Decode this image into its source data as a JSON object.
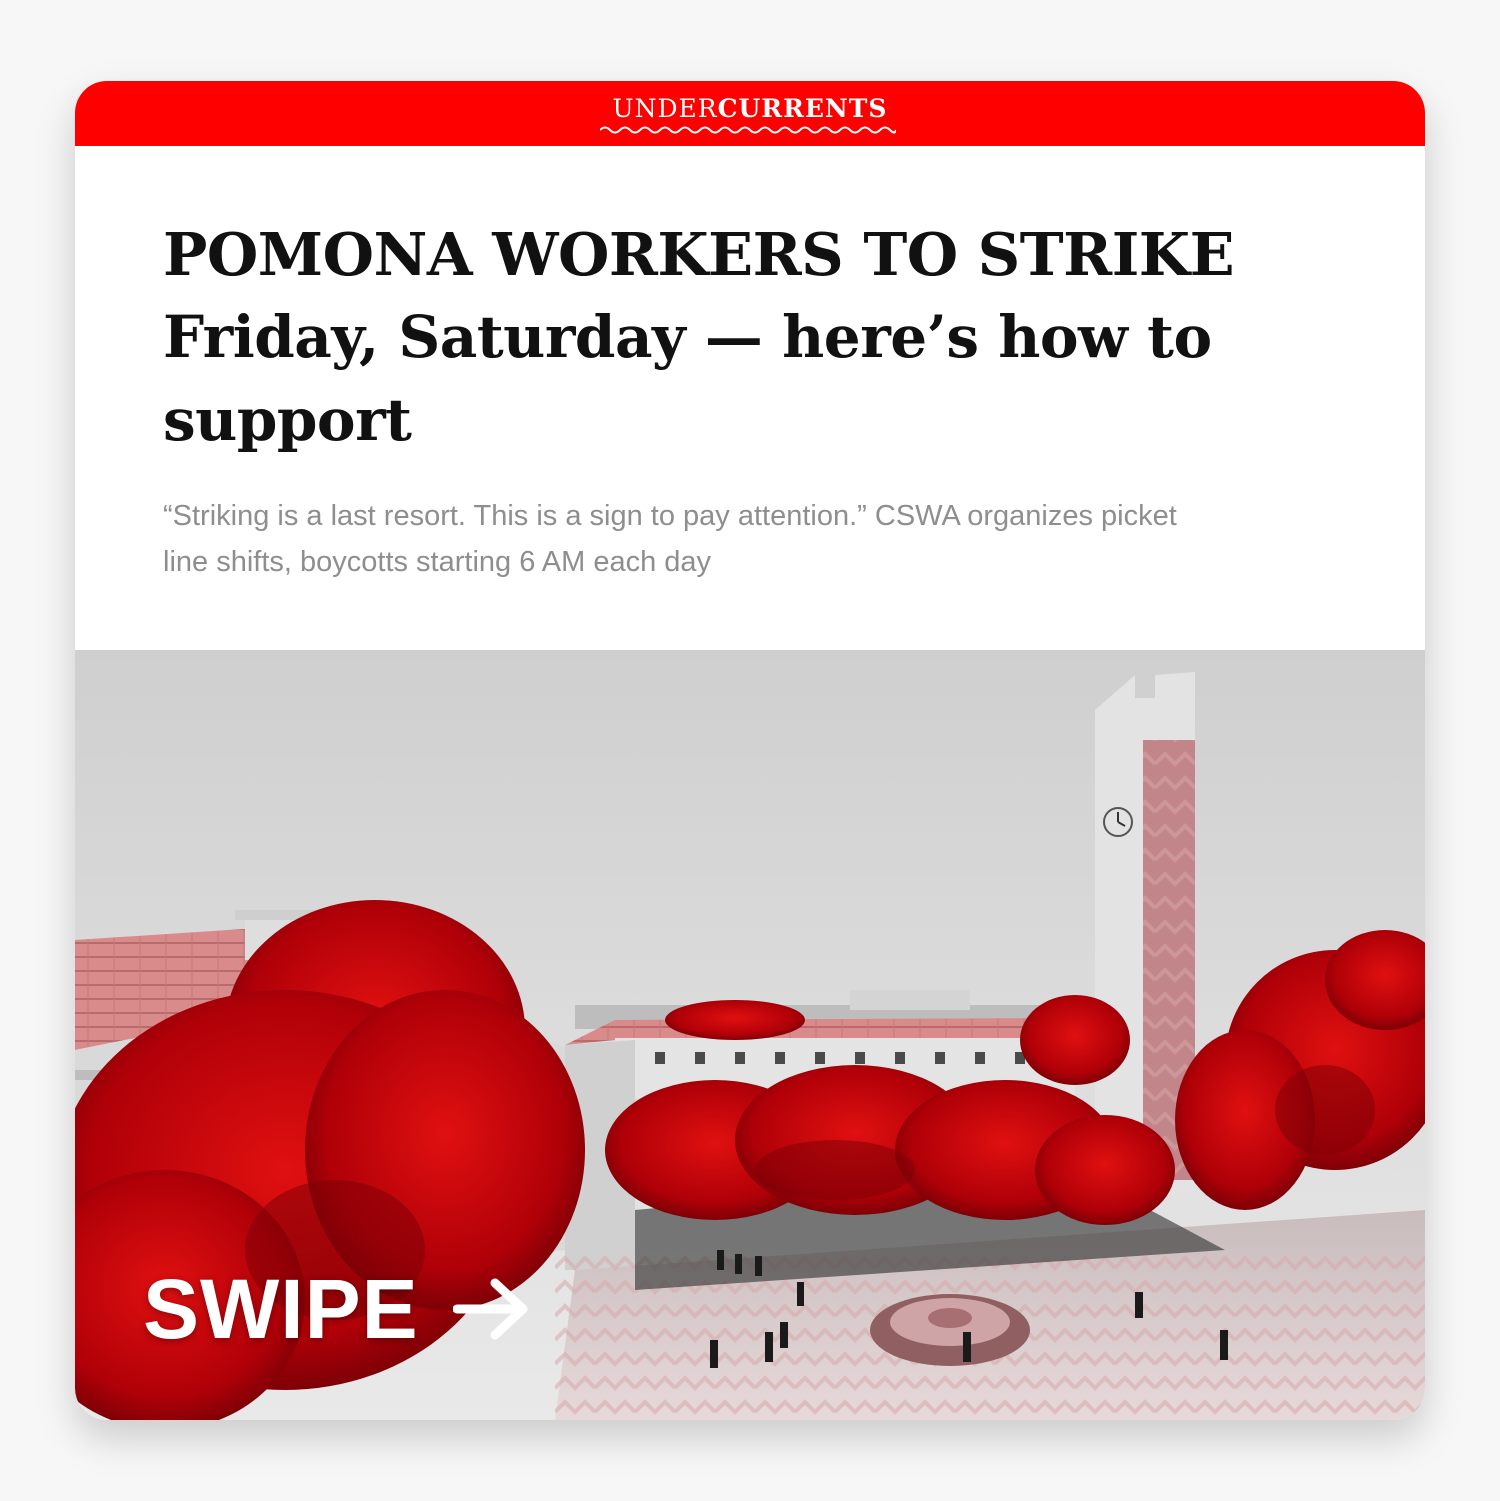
{
  "brand": {
    "name_part1": "UNDER",
    "name_part2": "CURRENTS",
    "bar_color": "#fe0000"
  },
  "article": {
    "headline_lines": [
      "POMONA WORKERS TO STRIKE",
      "Friday, Saturday — here’s how to",
      "support"
    ],
    "dek_lines": [
      "“Striking is a last resort. This is a sign to pay attention.” CSWA organizes picket",
      "line shifts, boycotts starting 6 AM each day"
    ]
  },
  "photo": {
    "subject": "campus-courtyard-clock-tower-red-trees"
  },
  "cta": {
    "label": "SWIPE",
    "icon": "arrow-right-icon"
  }
}
